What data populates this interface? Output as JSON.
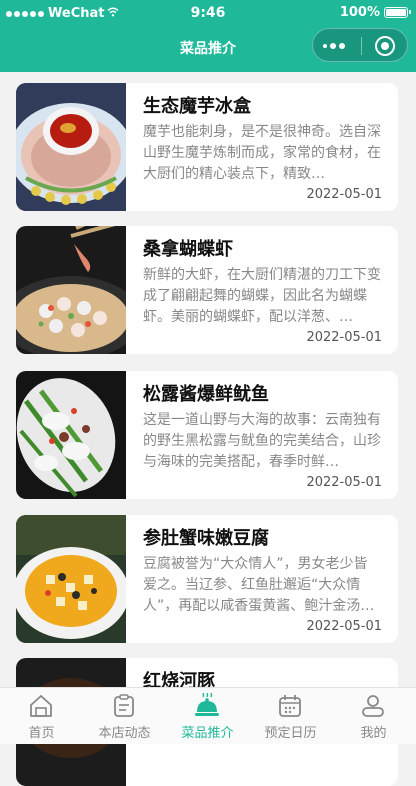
{
  "status_bar": {
    "carrier": "WeChat",
    "time": "9:46",
    "battery": "100%"
  },
  "nav": {
    "title": "菜品推介"
  },
  "dishes": [
    {
      "title": "生态魔芋冰盒",
      "desc": "魔芋也能刺身，是不是很神奇。选自深山野生魔芋炼制而成，家常的食材，在大厨们的精心装点下，精致…",
      "date": "2022-05-01"
    },
    {
      "title": "桑拿蝴蝶虾",
      "desc": "新鲜的大虾，在大厨们精湛的刀工下变成了翩翩起舞的蝴蝶，因此名为蝴蝶虾。美丽的蝴蝶虾，配以洋葱、…",
      "date": "2022-05-01"
    },
    {
      "title": "松露酱爆鲜鱿鱼",
      "desc": "这是一道山野与大海的故事：云南独有的野生黑松露与鱿鱼的完美结合，山珍与海味的完美搭配，春季时鲜…",
      "date": "2022-05-01"
    },
    {
      "title": "参肚蟹味嫩豆腐",
      "desc": "豆腐被誉为“大众情人”，男女老少皆爱之。当辽参、红鱼肚邂逅“大众情人”，再配以咸香蛋黄酱、鲍汁金汤…",
      "date": "2022-05-01"
    },
    {
      "title": "红烧河豚",
      "desc": "",
      "date": ""
    }
  ],
  "tabbar": {
    "items": [
      {
        "label": "首页",
        "icon": "home-icon"
      },
      {
        "label": "本店动态",
        "icon": "news-icon"
      },
      {
        "label": "菜品推介",
        "icon": "dish-cloche-icon"
      },
      {
        "label": "预定日历",
        "icon": "calendar-icon"
      },
      {
        "label": "我的",
        "icon": "profile-icon"
      }
    ],
    "active_index": 2
  },
  "colors": {
    "accent": "#1fb99a",
    "inactive": "#888888",
    "background": "#f2f2f2"
  }
}
